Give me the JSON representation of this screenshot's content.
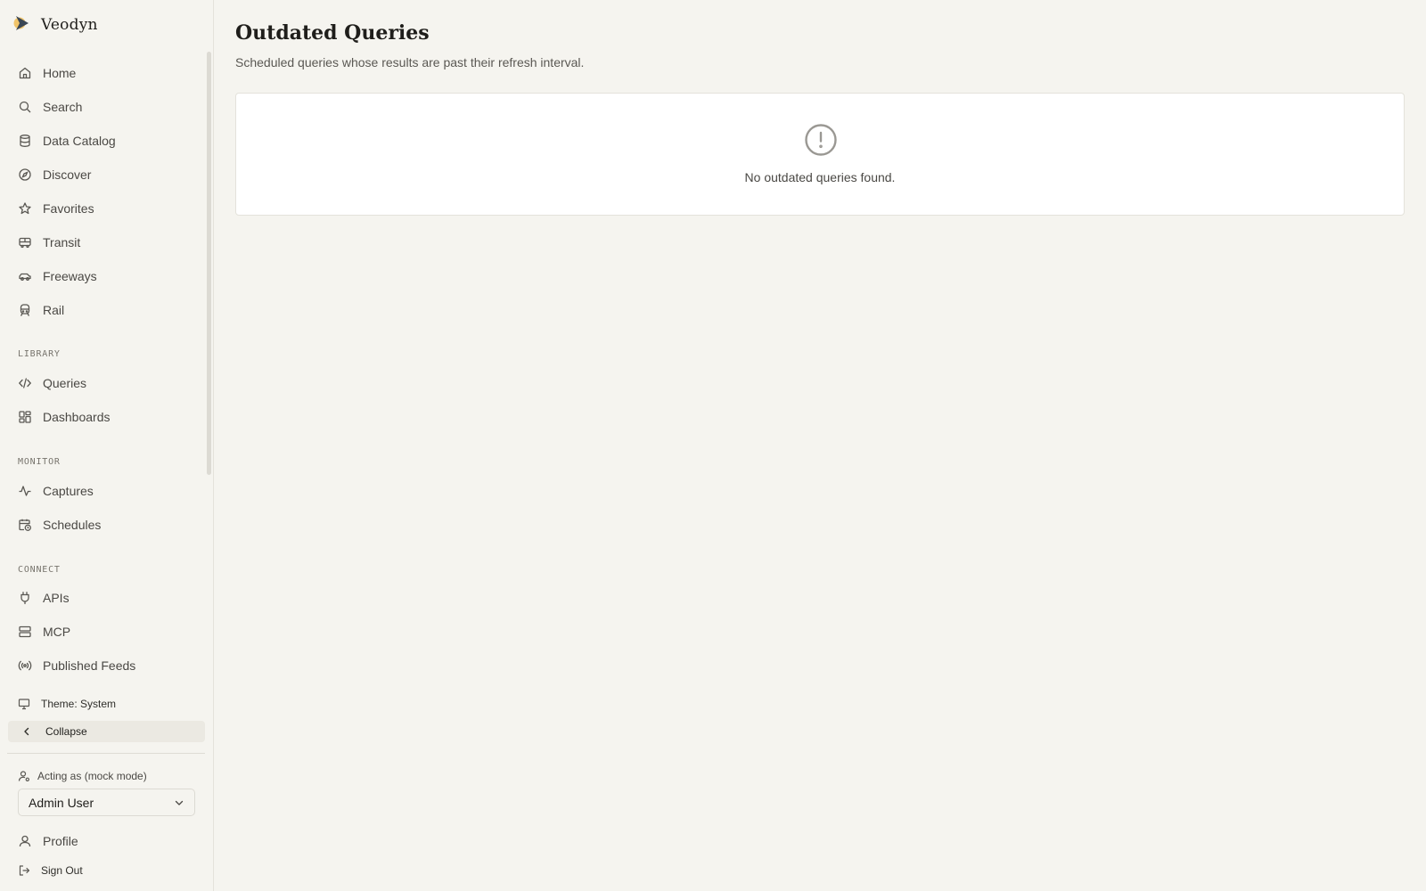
{
  "app": {
    "name": "Veodyn"
  },
  "sidebar": {
    "primary": [
      {
        "label": "Home",
        "icon": "home-icon"
      },
      {
        "label": "Search",
        "icon": "search-icon"
      },
      {
        "label": "Data Catalog",
        "icon": "database-icon"
      },
      {
        "label": "Discover",
        "icon": "compass-icon"
      },
      {
        "label": "Favorites",
        "icon": "star-icon"
      },
      {
        "label": "Transit",
        "icon": "bus-icon"
      },
      {
        "label": "Freeways",
        "icon": "car-icon"
      },
      {
        "label": "Rail",
        "icon": "train-icon"
      }
    ],
    "sections": [
      {
        "title": "LIBRARY",
        "items": [
          {
            "label": "Queries",
            "icon": "code-icon"
          },
          {
            "label": "Dashboards",
            "icon": "dashboard-icon"
          }
        ]
      },
      {
        "title": "MONITOR",
        "items": [
          {
            "label": "Captures",
            "icon": "activity-icon"
          },
          {
            "label": "Schedules",
            "icon": "calendar-clock-icon"
          }
        ]
      },
      {
        "title": "CONNECT",
        "items": [
          {
            "label": "APIs",
            "icon": "plug-icon"
          },
          {
            "label": "MCP",
            "icon": "server-icon"
          },
          {
            "label": "Published Feeds",
            "icon": "broadcast-icon"
          }
        ]
      }
    ],
    "theme_label": "Theme: System",
    "collapse_label": "Collapse",
    "acting_as_label": "Acting as (mock mode)",
    "acting_as_value": "Admin User",
    "profile_label": "Profile",
    "signout_label": "Sign Out"
  },
  "main": {
    "title": "Outdated Queries",
    "subtitle": "Scheduled queries whose results are past their refresh interval.",
    "empty_message": "No outdated queries found."
  },
  "colors": {
    "background": "#f5f4ef",
    "card": "#ffffff",
    "accent": "#e8a33d",
    "brand_dark": "#2b3a4a"
  }
}
